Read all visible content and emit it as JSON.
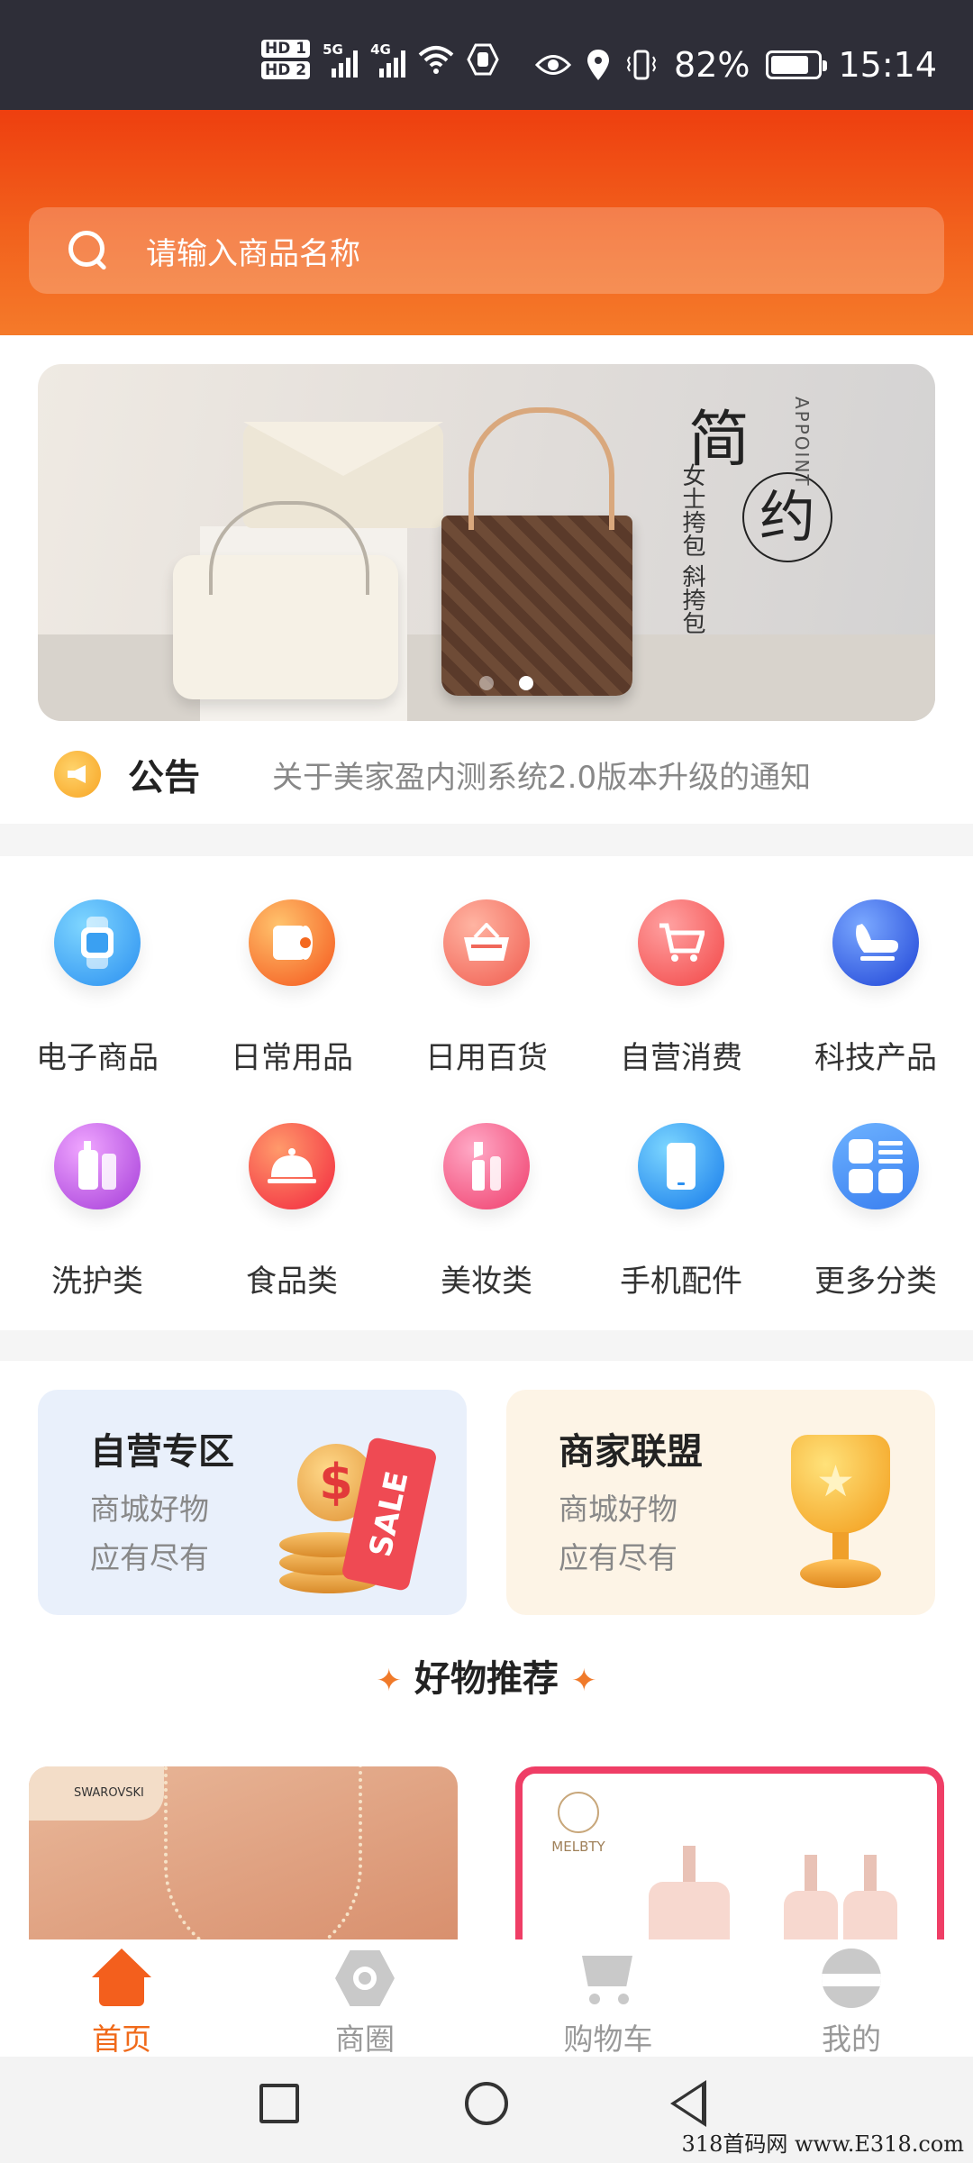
{
  "status_bar": {
    "hd1": "HD 1",
    "hd2": "HD 2",
    "net1": "5G",
    "net2": "4G",
    "battery": "82%",
    "battery_level": 0.82,
    "time": "15:14"
  },
  "search": {
    "placeholder": "请输入商品名称"
  },
  "banner": {
    "title_char1": "简",
    "title_char2": "约",
    "subtitle": "女士挎包 斜挎包",
    "brand_en": "APPOINT",
    "active_dot": 2,
    "dot_count": 2
  },
  "notice": {
    "label": "公告",
    "text": "关于美家盈内测系统2.0版本升级的通知"
  },
  "categories": [
    {
      "label": "电子商品",
      "icon": "watch-icon"
    },
    {
      "label": "日常用品",
      "icon": "tissue-roll-icon"
    },
    {
      "label": "日用百货",
      "icon": "basket-icon"
    },
    {
      "label": "自营消费",
      "icon": "cart-icon"
    },
    {
      "label": "科技产品",
      "icon": "massage-chair-icon"
    },
    {
      "label": "洗护类",
      "icon": "bottles-icon"
    },
    {
      "label": "食品类",
      "icon": "food-cloche-icon"
    },
    {
      "label": "美妆类",
      "icon": "lipstick-icon"
    },
    {
      "label": "手机配件",
      "icon": "phone-icon"
    },
    {
      "label": "更多分类",
      "icon": "grid-more-icon"
    }
  ],
  "promo": {
    "self_run": {
      "title": "自营专区",
      "line1": "商城好物",
      "line2": "应有尽有",
      "tag": "SALE"
    },
    "merchant": {
      "title": "商家联盟",
      "line1": "商城好物",
      "line2": "应有尽有"
    }
  },
  "recommend": {
    "title": "好物推荐",
    "left_brand": "SWAROVSKI",
    "right_brand": "MELBTY"
  },
  "tabbar": [
    {
      "label": "首页",
      "active": true
    },
    {
      "label": "商圈",
      "active": false
    },
    {
      "label": "购物车",
      "active": false
    },
    {
      "label": "我的",
      "active": false
    }
  ],
  "watermark": "318首码网 www.E318.com",
  "colors": {
    "accent": "#f06a1a",
    "header_top": "#ee3f0f",
    "header_bottom": "#f57a2a"
  }
}
